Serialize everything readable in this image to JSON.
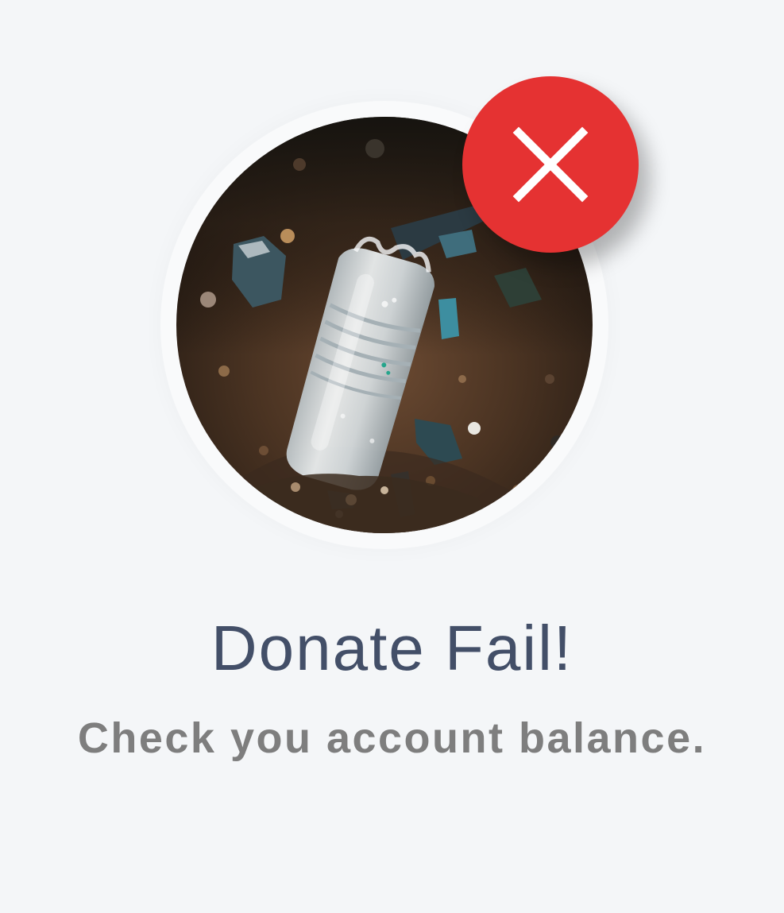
{
  "dialog": {
    "title": "Donate Fail!",
    "message": "Check you account balance."
  },
  "illustration": {
    "subject": "plastic bottle in soil",
    "status_icon": "close-icon"
  },
  "colors": {
    "background": "#f4f6f8",
    "title": "#434f68",
    "message": "#7e7e7e",
    "error": "#e53232",
    "icon": "#ffffff"
  }
}
